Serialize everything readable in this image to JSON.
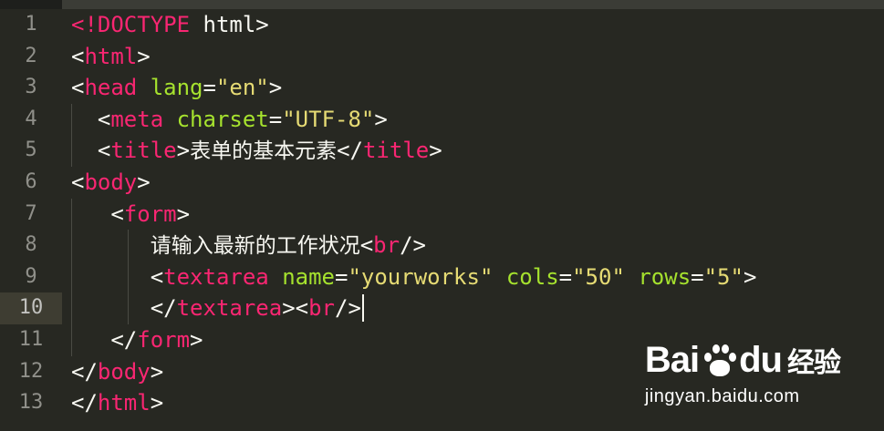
{
  "lines": [
    {
      "num": "1",
      "parts": [
        [
          "tag",
          "<!DOCTYPE"
        ],
        [
          "punct",
          " html>"
        ]
      ]
    },
    {
      "num": "2",
      "parts": [
        [
          "punct",
          "<"
        ],
        [
          "tag",
          "html"
        ],
        [
          "punct",
          ">"
        ]
      ]
    },
    {
      "num": "3",
      "parts": [
        [
          "punct",
          "<"
        ],
        [
          "tag",
          "head"
        ],
        [
          "punct",
          " "
        ],
        [
          "attr",
          "lang"
        ],
        [
          "punct",
          "="
        ],
        [
          "str",
          "\"en\""
        ],
        [
          "punct",
          ">"
        ]
      ]
    },
    {
      "num": "4",
      "parts": [
        [
          "punct",
          "  <"
        ],
        [
          "tag",
          "meta"
        ],
        [
          "punct",
          " "
        ],
        [
          "attr",
          "charset"
        ],
        [
          "punct",
          "="
        ],
        [
          "str",
          "\"UTF-8\""
        ],
        [
          "punct",
          ">"
        ]
      ]
    },
    {
      "num": "5",
      "parts": [
        [
          "punct",
          "  <"
        ],
        [
          "tag",
          "title"
        ],
        [
          "punct",
          ">"
        ],
        [
          "text",
          "表单的基本元素"
        ],
        [
          "punct",
          "</"
        ],
        [
          "tag",
          "title"
        ],
        [
          "punct",
          ">"
        ]
      ]
    },
    {
      "num": "6",
      "parts": [
        [
          "punct",
          "<"
        ],
        [
          "tag",
          "body"
        ],
        [
          "punct",
          ">"
        ]
      ]
    },
    {
      "num": "7",
      "parts": [
        [
          "punct",
          "   <"
        ],
        [
          "tag",
          "form"
        ],
        [
          "punct",
          ">"
        ]
      ]
    },
    {
      "num": "8",
      "parts": [
        [
          "punct",
          "      "
        ],
        [
          "text",
          "请输入最新的工作状况"
        ],
        [
          "punct",
          "<"
        ],
        [
          "tag",
          "br"
        ],
        [
          "punct",
          "/>"
        ]
      ]
    },
    {
      "num": "9",
      "parts": [
        [
          "punct",
          "      <"
        ],
        [
          "tag",
          "textarea"
        ],
        [
          "punct",
          " "
        ],
        [
          "attr",
          "name"
        ],
        [
          "punct",
          "="
        ],
        [
          "str",
          "\"yourworks\""
        ],
        [
          "punct",
          " "
        ],
        [
          "attr",
          "cols"
        ],
        [
          "punct",
          "="
        ],
        [
          "str",
          "\"50\""
        ],
        [
          "punct",
          " "
        ],
        [
          "attr",
          "rows"
        ],
        [
          "punct",
          "="
        ],
        [
          "str",
          "\"5\""
        ],
        [
          "punct",
          ">"
        ]
      ]
    },
    {
      "num": "10",
      "parts": [
        [
          "punct",
          "      </"
        ],
        [
          "tag",
          "textarea"
        ],
        [
          "punct",
          "><"
        ],
        [
          "tag",
          "br"
        ],
        [
          "punct",
          "/>"
        ]
      ],
      "current": true
    },
    {
      "num": "11",
      "parts": [
        [
          "punct",
          "   </"
        ],
        [
          "tag",
          "form"
        ],
        [
          "punct",
          ">"
        ]
      ]
    },
    {
      "num": "12",
      "parts": [
        [
          "punct",
          "</"
        ],
        [
          "tag",
          "body"
        ],
        [
          "punct",
          ">"
        ]
      ]
    },
    {
      "num": "13",
      "parts": [
        [
          "punct",
          "</"
        ],
        [
          "tag",
          "html"
        ],
        [
          "punct",
          ">"
        ]
      ]
    }
  ],
  "watermark": {
    "logo_left": "Bai",
    "logo_right": "du",
    "logo_cn": "经验",
    "url": "jingyan.baidu.com"
  },
  "colors": {
    "background": "#272822",
    "tag": "#f92672",
    "attribute": "#a6e22e",
    "string": "#e6db74",
    "text": "#f8f8f2",
    "gutter_text": "#90908a"
  }
}
